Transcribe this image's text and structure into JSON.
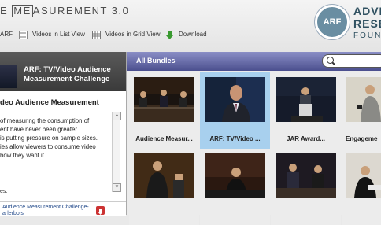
{
  "header": {
    "title_prefix": "E ",
    "title_me": "ME",
    "title_suffix": "ASUREMENT 3.0",
    "toolbar": {
      "arf_label": "ARF",
      "list_label": "Videos in List View",
      "grid_label": "Videos in Grid View",
      "download_label": "Download"
    },
    "logo": {
      "circle_text": "ARF",
      "line1": "ADVE",
      "line2": "RESE",
      "line3": "FOUN"
    }
  },
  "now_playing": {
    "title": "ARF: TV/Video Audience Measurement Challenge"
  },
  "description": {
    "title": "deo Audience Measurement",
    "body_lines": [
      "of measuring the consumption of",
      "ent have never been greater.",
      "is putting pressure on sample sizes.",
      "ies allow viewers to consume video",
      "how they want it"
    ]
  },
  "files": {
    "label": "es:",
    "file_line1": "Audience Measurement Challenge-",
    "file_line2": "arlerbois"
  },
  "bundles": {
    "title": "All Bundles",
    "search_placeholder": "",
    "tiles": [
      {
        "label": "Audience Measur..."
      },
      {
        "label": "ARF:  TV/Video ..."
      },
      {
        "label": "JAR Award..."
      },
      {
        "label": "Engageme"
      },
      {
        "label": ""
      },
      {
        "label": ""
      },
      {
        "label": ""
      },
      {
        "label": ""
      }
    ]
  },
  "colors": {
    "bundles_bar": "#5a5e9e",
    "selected_tile": "#a8d0ee",
    "now_playing_bar": "#444444",
    "logo_circle": "#6a8ea2"
  },
  "icons": {
    "list_view": "list-icon",
    "grid_view": "grid-icon",
    "download": "download-arrow-icon",
    "search": "search-icon",
    "file_download": "file-download-icon"
  }
}
